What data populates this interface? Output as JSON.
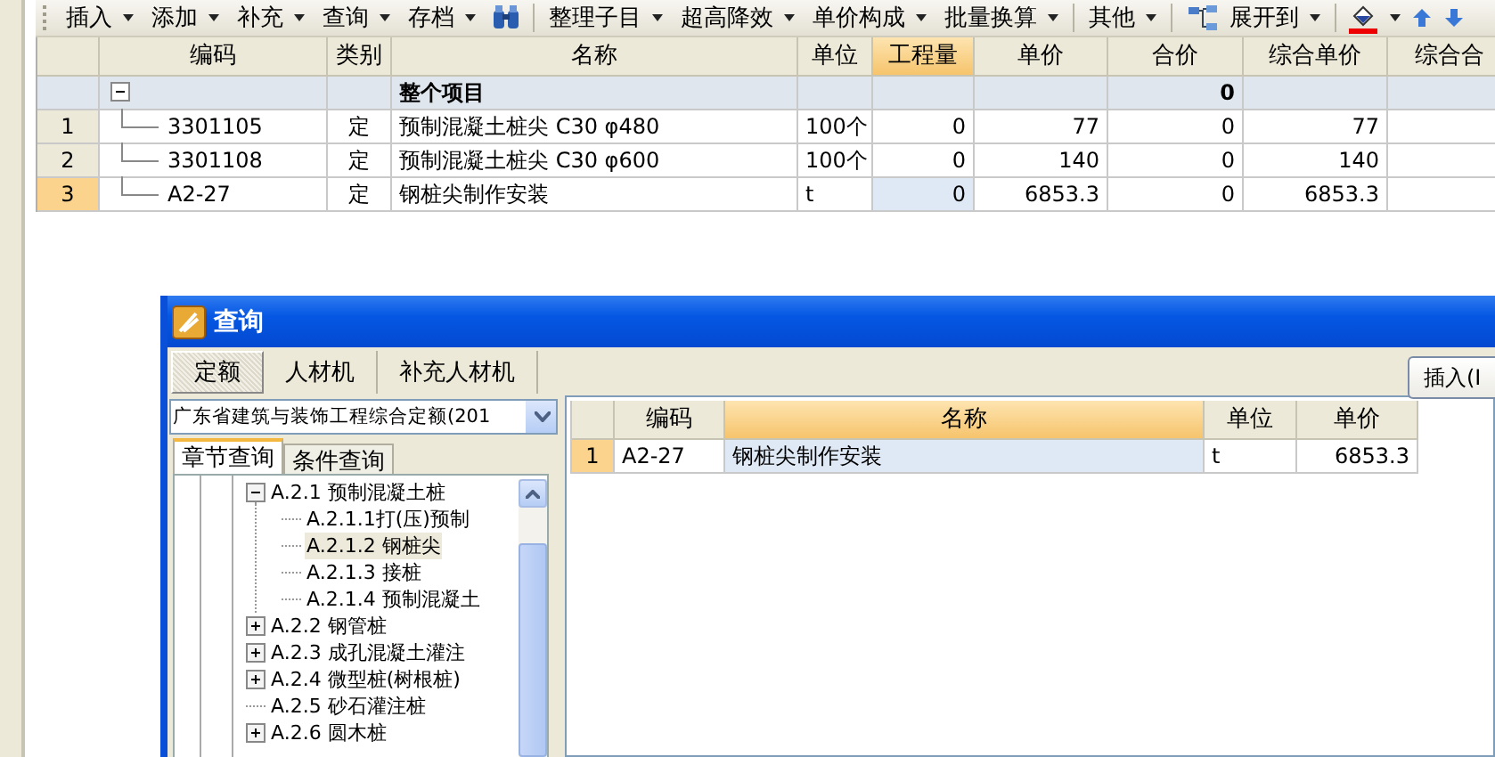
{
  "toolbar": {
    "groups": [
      [
        "插入",
        "添加",
        "补充",
        "查询",
        "存档"
      ],
      [
        "整理子目",
        "超高降效",
        "单价构成",
        "批量换算"
      ],
      [
        "其他"
      ],
      [
        "展开到"
      ]
    ]
  },
  "main_table": {
    "columns": [
      {
        "label": "编码",
        "selected": false
      },
      {
        "label": "类别",
        "selected": false
      },
      {
        "label": "名称",
        "selected": false
      },
      {
        "label": "单位",
        "selected": false
      },
      {
        "label": "工程量",
        "selected": true
      },
      {
        "label": "单价",
        "selected": false
      },
      {
        "label": "合价",
        "selected": false
      },
      {
        "label": "综合单价",
        "selected": false
      },
      {
        "label": "综合合",
        "selected": false
      }
    ],
    "rows": [
      {
        "kind": "group",
        "expanded": true,
        "name": "整个项目",
        "total": "0",
        "selected": false
      },
      {
        "kind": "item",
        "number": "1",
        "code": "3301105",
        "type": "定",
        "name": "预制混凝土桩尖 C30 φ480",
        "unit": "100个",
        "quantity": "0",
        "price": "77",
        "total": "0",
        "composite_price": "77",
        "selected": false
      },
      {
        "kind": "item",
        "number": "2",
        "code": "3301108",
        "type": "定",
        "name": "预制混凝土桩尖 C30 φ600",
        "unit": "100个",
        "quantity": "0",
        "price": "140",
        "total": "0",
        "composite_price": "140",
        "selected": false
      },
      {
        "kind": "item",
        "number": "3",
        "code": "A2-27",
        "type": "定",
        "name": "钢桩尖制作安装",
        "unit": "t",
        "quantity": "0",
        "price": "6853.3",
        "total": "0",
        "composite_price": "6853.3",
        "selected": true
      }
    ]
  },
  "dialog": {
    "title": "查询",
    "tabs": [
      {
        "label": "定额",
        "selected": true
      },
      {
        "label": "人材机",
        "selected": false
      },
      {
        "label": "补充人材机",
        "selected": false
      }
    ],
    "insert_button": "插入(I",
    "library_select": "广东省建筑与装饰工程综合定额(201",
    "subtabs": [
      {
        "label": "章节查询",
        "selected": true
      },
      {
        "label": "条件查询",
        "selected": false
      }
    ],
    "tree": [
      {
        "label": "A.2.1 预制混凝土桩",
        "expanded": true,
        "selected": false,
        "children": [
          {
            "label": "A.2.1.1打(压)预制",
            "selected": false
          },
          {
            "label": "A.2.1.2 钢桩尖",
            "selected": true
          },
          {
            "label": "A.2.1.3 接桩",
            "selected": false
          },
          {
            "label": "A.2.1.4 预制混凝土",
            "selected": false
          }
        ]
      },
      {
        "label": "A.2.2 钢管桩",
        "expanded": false,
        "selected": false
      },
      {
        "label": "A.2.3 成孔混凝土灌注",
        "expanded": false,
        "selected": false
      },
      {
        "label": "A.2.4 微型桩(树根桩)",
        "expanded": false,
        "selected": false
      },
      {
        "label": "A.2.5 砂石灌注桩",
        "selected": false
      },
      {
        "label": "A.2.6 圆木桩",
        "expanded": false,
        "selected": false
      }
    ],
    "table": {
      "columns": [
        {
          "label": "编码",
          "selected": false
        },
        {
          "label": "名称",
          "selected": true
        },
        {
          "label": "单位",
          "selected": false
        },
        {
          "label": "单价",
          "selected": false
        }
      ],
      "rows": [
        {
          "number": "1",
          "code": "A2-27",
          "name": "钢桩尖制作安装",
          "unit": "t",
          "price": "6853.3",
          "selected": true
        }
      ]
    }
  }
}
